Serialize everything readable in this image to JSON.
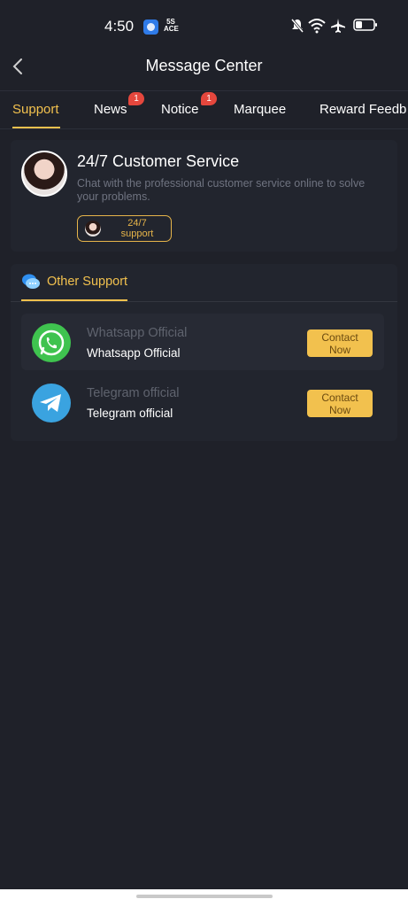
{
  "status_bar": {
    "time": "4:50",
    "tag": "5S ACE",
    "icons": [
      "app-icon",
      "mute-icon",
      "wifi-icon",
      "airplane-icon",
      "battery-icon"
    ]
  },
  "header": {
    "title": "Message Center",
    "back_icon": "chevron-left-icon"
  },
  "tabs": [
    {
      "label": "Support",
      "active": true
    },
    {
      "label": "News",
      "badge": "1"
    },
    {
      "label": "Notice",
      "badge": "1"
    },
    {
      "label": "Marquee"
    },
    {
      "label": "Reward Feedb"
    }
  ],
  "customer_service": {
    "title": "24/7 Customer Service",
    "description": "Chat with the professional customer service online to solve your problems.",
    "chip_line1": "24/7",
    "chip_line2": "support"
  },
  "other_support": {
    "title": "Other Support",
    "contacts": [
      {
        "name_muted": "Whatsapp Official",
        "name": "Whatsapp Official",
        "button_line1": "Contact",
        "button_line2": "Now",
        "icon": "whatsapp-icon"
      },
      {
        "name_muted": "Telegram official",
        "name": "Telegram official",
        "button_line1": "Contact",
        "button_line2": "Now",
        "icon": "telegram-icon"
      }
    ]
  },
  "colors": {
    "background": "#1f2129",
    "card": "#22252e",
    "accent": "#f2c14e",
    "badge": "#e5473d",
    "whatsapp": "#3fc34f",
    "telegram": "#3aa3e0"
  }
}
